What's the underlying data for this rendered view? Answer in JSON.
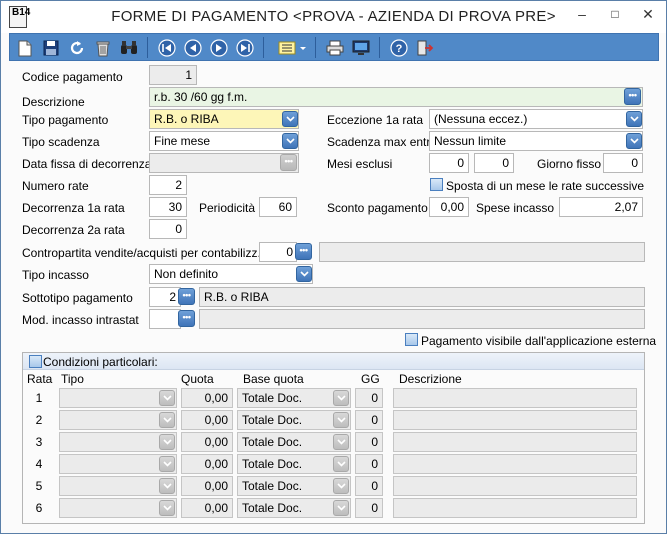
{
  "window": {
    "title": "FORME DI PAGAMENTO <PROVA - AZIENDA DI PROVA PRE>",
    "app_icon_text": "B14"
  },
  "colors": {
    "toolbar": "#5089c8",
    "highlight_field": "#fdf6b8",
    "description_field": "#e9f5e4"
  },
  "fields": {
    "codice_pagamento": {
      "label": "Codice pagamento",
      "value": "1"
    },
    "descrizione": {
      "label": "Descrizione",
      "value": "r.b. 30 /60 gg f.m."
    },
    "tipo_pagamento": {
      "label": "Tipo pagamento",
      "value": "R.B. o RIBA"
    },
    "eccezione_1a_rata": {
      "label": "Eccezione 1a rata",
      "value": "(Nessuna eccez.)"
    },
    "tipo_scadenza": {
      "label": "Tipo scadenza",
      "value": "Fine mese"
    },
    "scadenza_max_entro": {
      "label": "Scadenza max entro",
      "value": "Nessun limite"
    },
    "data_fissa_decorrenza": {
      "label": "Data fissa di decorrenza",
      "value": ""
    },
    "mesi_esclusi": {
      "label": "Mesi esclusi",
      "value1": "0",
      "value2": "0"
    },
    "giorno_fisso": {
      "label": "Giorno fisso",
      "value": "0"
    },
    "numero_rate": {
      "label": "Numero rate",
      "value": "2"
    },
    "sposta_mese": {
      "label": "Sposta di un mese le rate successive"
    },
    "decorrenza_1a_rata": {
      "label": "Decorrenza 1a rata",
      "value": "30"
    },
    "periodicita": {
      "label": "Periodicità",
      "value": "60"
    },
    "sconto_pagamento": {
      "label": "Sconto pagamento",
      "value": "0,00"
    },
    "spese_incasso": {
      "label": "Spese incasso",
      "value": "2,07"
    },
    "decorrenza_2a_rata": {
      "label": "Decorrenza 2a rata",
      "value": "0"
    },
    "contropartita": {
      "label": "Contropartita vendite/acquisti per contabilizz.",
      "value": "0",
      "desc": ""
    },
    "tipo_incasso": {
      "label": "Tipo incasso",
      "value": "Non definito"
    },
    "sottotipo_pagamento": {
      "label": "Sottotipo pagamento",
      "value": "2",
      "desc": "R.B. o RIBA"
    },
    "mod_incasso_intrastat": {
      "label": "Mod. incasso intrastat",
      "value": "",
      "desc": ""
    },
    "pagamento_visibile": {
      "label": "Pagamento visibile dall'applicazione esterna"
    }
  },
  "conditions": {
    "title": "Condizioni particolari:",
    "headers": [
      "Rata",
      "Tipo",
      "Quota",
      "Base quota",
      "GG",
      "Descrizione"
    ],
    "rows": [
      {
        "rata": "1",
        "tipo": "",
        "quota": "0,00",
        "base": "Totale Doc.",
        "gg": "0",
        "desc": ""
      },
      {
        "rata": "2",
        "tipo": "",
        "quota": "0,00",
        "base": "Totale Doc.",
        "gg": "0",
        "desc": ""
      },
      {
        "rata": "3",
        "tipo": "",
        "quota": "0,00",
        "base": "Totale Doc.",
        "gg": "0",
        "desc": ""
      },
      {
        "rata": "4",
        "tipo": "",
        "quota": "0,00",
        "base": "Totale Doc.",
        "gg": "0",
        "desc": ""
      },
      {
        "rata": "5",
        "tipo": "",
        "quota": "0,00",
        "base": "Totale Doc.",
        "gg": "0",
        "desc": ""
      },
      {
        "rata": "6",
        "tipo": "",
        "quota": "0,00",
        "base": "Totale Doc.",
        "gg": "0",
        "desc": ""
      }
    ]
  },
  "toolbar_icons": [
    "new-icon",
    "save-icon",
    "undo-icon",
    "delete-icon",
    "find-icon",
    "first-record-icon",
    "previous-record-icon",
    "next-record-icon",
    "last-record-icon",
    "list-options-icon",
    "print-icon",
    "preview-icon",
    "help-icon",
    "exit-icon"
  ]
}
